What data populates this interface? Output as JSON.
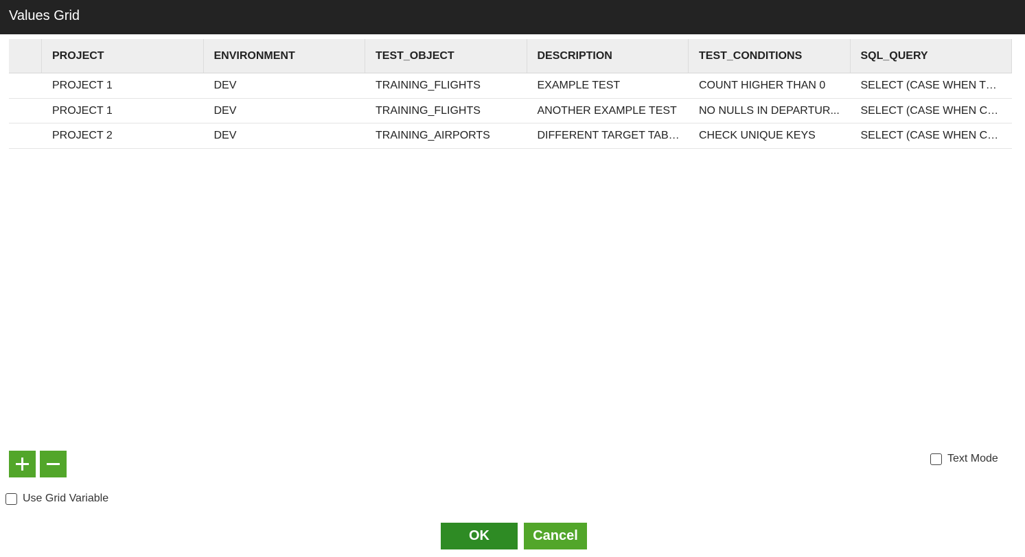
{
  "dialog": {
    "title": "Values Grid"
  },
  "grid": {
    "columns": [
      "PROJECT",
      "ENVIRONMENT",
      "TEST_OBJECT",
      "DESCRIPTION",
      "TEST_CONDITIONS",
      "SQL_QUERY"
    ],
    "rows": [
      [
        "PROJECT 1",
        "DEV",
        "TRAINING_FLIGHTS",
        "EXAMPLE TEST",
        "COUNT HIGHER THAN 0",
        "SELECT (CASE WHEN TOT..."
      ],
      [
        "PROJECT 1",
        "DEV",
        "TRAINING_FLIGHTS",
        "ANOTHER EXAMPLE TEST",
        "NO NULLS IN DEPARTUR...",
        "SELECT (CASE WHEN CO..."
      ],
      [
        "PROJECT 2",
        "DEV",
        "TRAINING_AIRPORTS",
        "DIFFERENT TARGET TABLE",
        "CHECK UNIQUE KEYS",
        "SELECT (CASE WHEN CO..."
      ]
    ]
  },
  "controls": {
    "add_icon": "plus-icon",
    "remove_icon": "minus-icon",
    "text_mode_label": "Text Mode",
    "text_mode_checked": false,
    "grid_variable_label": "Use Grid Variable",
    "grid_variable_checked": false
  },
  "footer": {
    "ok_label": "OK",
    "cancel_label": "Cancel"
  },
  "colors": {
    "titlebar": "#232323",
    "ok_button": "#2e8b24",
    "green_button": "#52a62a",
    "header_bg": "#eeeeee"
  }
}
